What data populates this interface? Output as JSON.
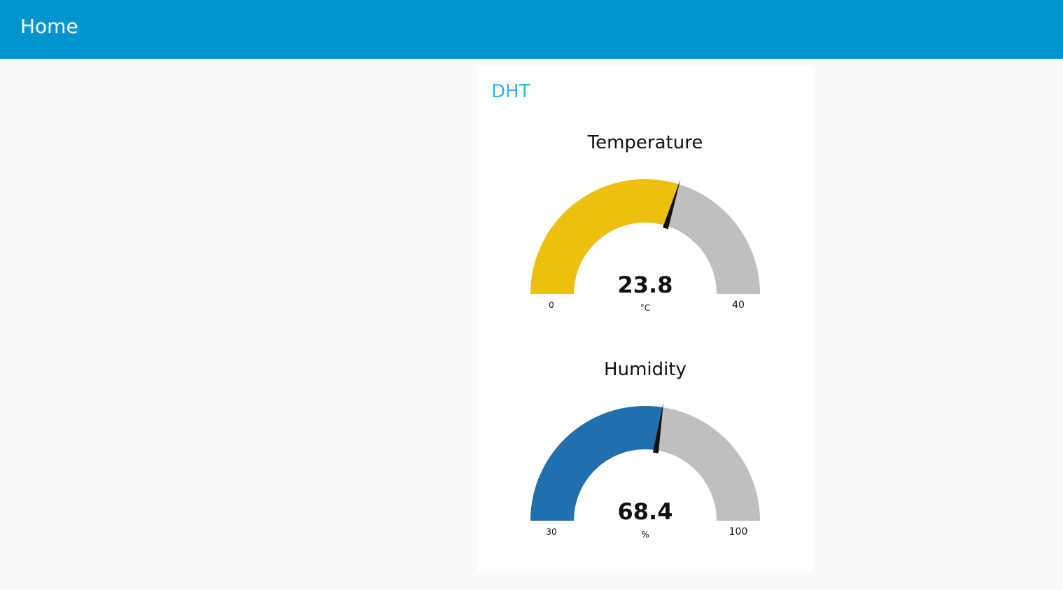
{
  "header": {
    "title": "Home"
  },
  "group": {
    "title": "DHT"
  },
  "gauges": [
    {
      "title": "Temperature",
      "value": 23.8,
      "value_text": "23.8",
      "unit": "°C",
      "min": 0,
      "max": 40,
      "min_label": "0",
      "max_label": "40",
      "color": "#edc010"
    },
    {
      "title": "Humidity",
      "value": 68.4,
      "value_text": "68.4",
      "unit": "%",
      "min": 30,
      "max": 100,
      "min_label": "30",
      "max_label": "100",
      "color": "#2170ad"
    }
  ],
  "colors": {
    "header": "#0094ce",
    "group_title": "#2fb4f0",
    "track": "#bfbfbf",
    "needle": "#111111"
  }
}
